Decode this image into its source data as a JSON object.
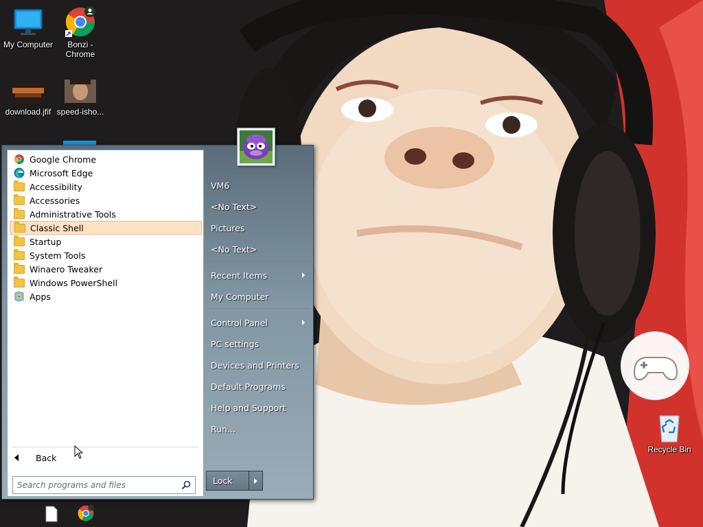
{
  "desktop": {
    "icons": [
      {
        "label": "My Computer",
        "icon": "monitor-icon"
      },
      {
        "label": "Bonzi -\nChrome",
        "icon": "chrome-shortcut-icon"
      },
      {
        "label": "download.jfif",
        "icon": "image-file-icon"
      },
      {
        "label": "speed-isho...",
        "icon": "image-file-icon"
      },
      {
        "label": "Recycle Bin",
        "icon": "recycle-bin-icon"
      }
    ]
  },
  "start_menu": {
    "programs": [
      {
        "label": "Google Chrome",
        "icon": "chrome-icon"
      },
      {
        "label": "Microsoft Edge",
        "icon": "edge-icon"
      },
      {
        "label": "Accessibility",
        "icon": "folder-icon"
      },
      {
        "label": "Accessories",
        "icon": "folder-icon"
      },
      {
        "label": "Administrative Tools",
        "icon": "folder-icon"
      },
      {
        "label": "Classic Shell",
        "icon": "folder-icon",
        "selected": true
      },
      {
        "label": "Startup",
        "icon": "folder-icon"
      },
      {
        "label": "System Tools",
        "icon": "folder-icon"
      },
      {
        "label": "Winaero Tweaker",
        "icon": "folder-icon"
      },
      {
        "label": "Windows PowerShell",
        "icon": "folder-icon"
      },
      {
        "label": "Apps",
        "icon": "apps-icon"
      }
    ],
    "back_label": "Back",
    "search": {
      "placeholder": "Search programs and files",
      "value": ""
    },
    "right_column": [
      {
        "label": "VM6",
        "has_submenu": false
      },
      {
        "label": "<No Text>",
        "has_submenu": false
      },
      {
        "label": "Pictures",
        "has_submenu": false
      },
      {
        "label": "<No Text>",
        "has_submenu": false
      },
      {
        "label": "Recent Items",
        "has_submenu": true
      },
      {
        "label": "My Computer",
        "has_submenu": false
      },
      {
        "label": "Control Panel",
        "has_submenu": true
      },
      {
        "label": "PC settings",
        "has_submenu": false
      },
      {
        "label": "Devices and Printers",
        "has_submenu": false
      },
      {
        "label": "Default Programs",
        "has_submenu": false
      },
      {
        "label": "Help and Support",
        "has_submenu": false
      },
      {
        "label": "Run...",
        "has_submenu": false
      }
    ],
    "lock_label": "Lock",
    "user_picture": "bonzi-avatar"
  },
  "colors": {
    "selection_bg": "#fde2c4",
    "selection_border": "#f4bb86",
    "menu_gradient_top": "#5b6d7a",
    "menu_gradient_bottom": "#9aacb8"
  }
}
